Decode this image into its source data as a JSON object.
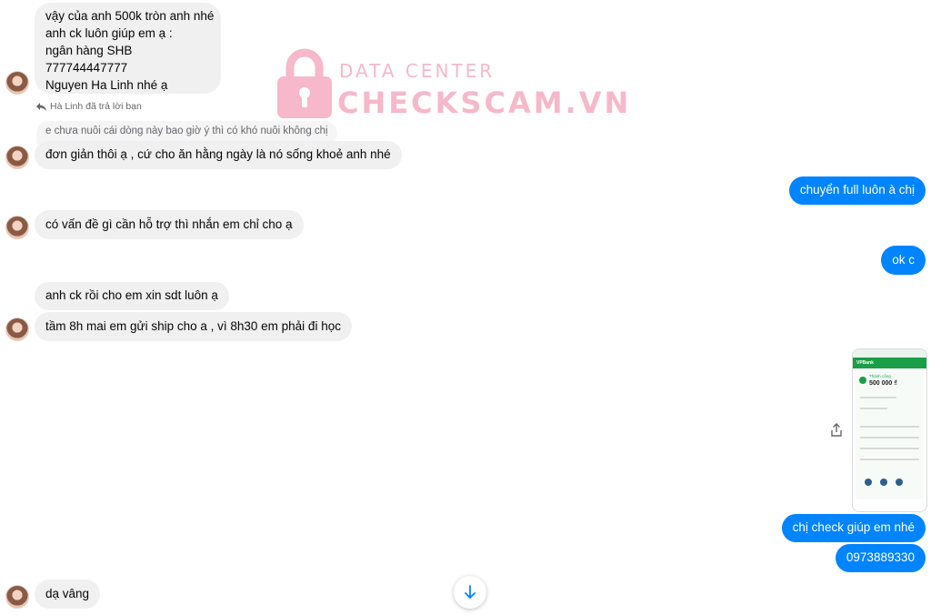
{
  "watermark": {
    "top": "DATA CENTER",
    "main": "CHECKSCAM.VN"
  },
  "messages": {
    "m1": [
      "vậy của anh 500k tròn anh nhé",
      "anh ck luôn giúp em ạ :",
      "ngân hàng SHB",
      "777744447777",
      "Nguyen Ha Linh nhé ạ"
    ],
    "reply_label": "Hà Linh đã trả lời bạn",
    "quoted": "e chưa nuôi cái dòng này bao giờ ý thì có khó nuôi không chị",
    "m2": "đơn giản thôi ạ , cứ cho ăn hằng ngày là nó sống khoẻ anh nhé",
    "o1": "chuyển full luôn à chị",
    "m3": "có vấn đề gì cần hỗ trợ thì nhắn em chỉ cho ạ",
    "o2": "ok c",
    "m4": "anh ck rồi cho em xin sdt luôn ạ",
    "m5": "tầm 8h mai em gửi ship cho a , vì 8h30 em phải đi học",
    "o3": "chị check giúp em nhé",
    "o4": "0973889330",
    "m6": "dạ vâng"
  },
  "receipt": {
    "status": "Thành công",
    "amount": "500 000 ₫",
    "header": "VPBank"
  },
  "colors": {
    "outgoing": "#0084ff",
    "incoming": "#f0f0f0",
    "watermark": "#f07fa0"
  }
}
